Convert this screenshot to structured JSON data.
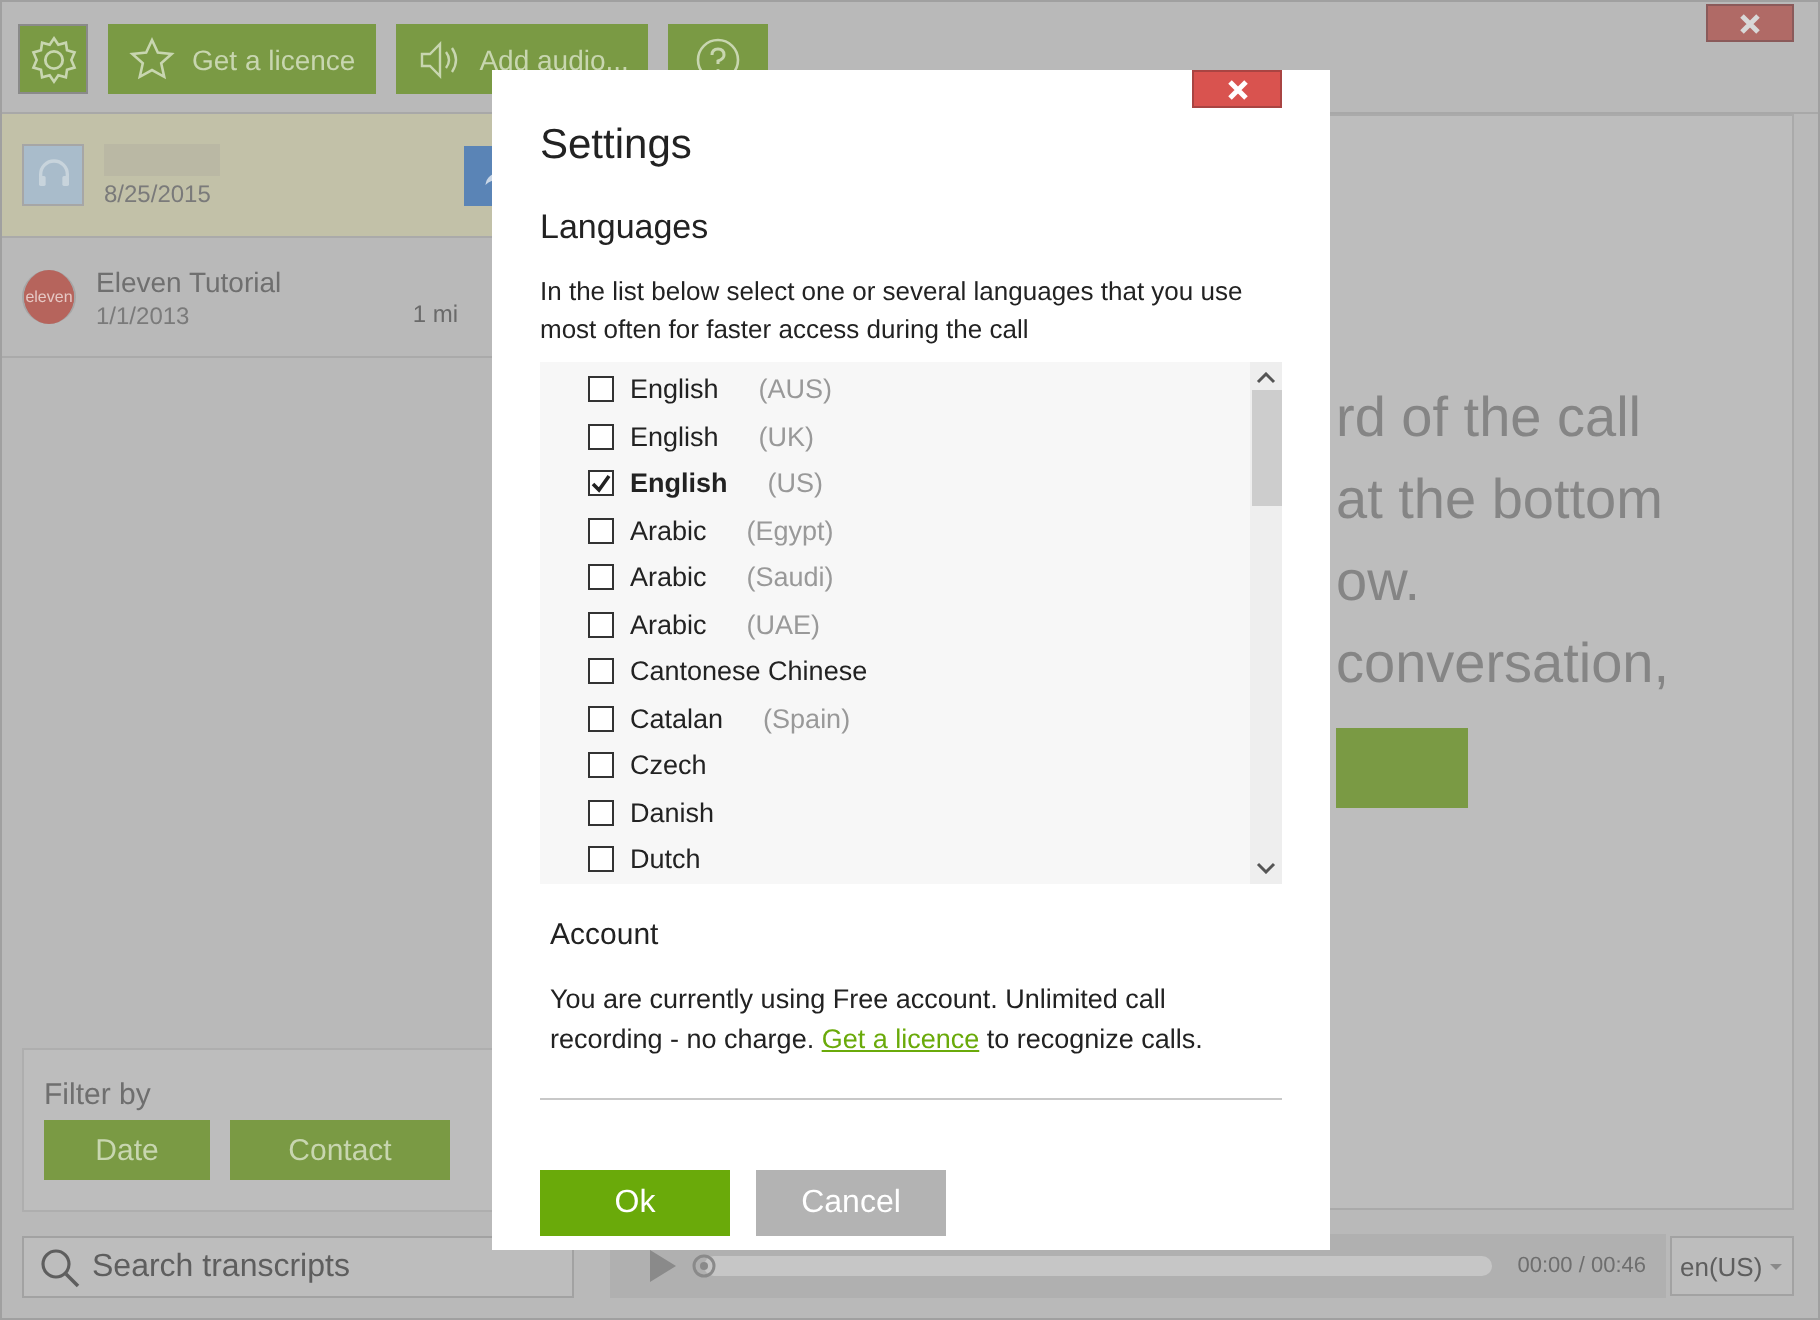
{
  "toolbar": [
    {
      "kind": "settings"
    },
    {
      "kind": "licence",
      "label": "Get a licence"
    },
    {
      "kind": "audio",
      "label": "Add audio..."
    },
    {
      "kind": "help"
    }
  ],
  "calls": [
    {
      "kind": "headset",
      "date": "8/25/2015",
      "selected": true
    },
    {
      "kind": "logo",
      "avatar_text": "eleven",
      "title": "Eleven Tutorial",
      "date": "1/1/2013",
      "duration": "1 mi",
      "selected": false
    }
  ],
  "filter": {
    "title": "Filter by",
    "buttons": [
      "Date",
      "Contact"
    ]
  },
  "search": {
    "placeholder": "Search transcripts"
  },
  "hint_lines": [
    "rd of the call",
    "at the bottom",
    "ow.",
    "conversation,"
  ],
  "player": {
    "level": 0,
    "time": "00:00 / 00:46"
  },
  "language_select": {
    "value": "en(US)"
  },
  "dialog": {
    "title": "Settings",
    "languages": {
      "heading": "Languages",
      "description": "In the list below select one or several languages that you use most often for faster access during the call",
      "items": [
        {
          "name": "English",
          "region": "(AUS)",
          "checked": false
        },
        {
          "name": "English",
          "region": "(UK)",
          "checked": false
        },
        {
          "name": "English",
          "region": "(US)",
          "checked": true
        },
        {
          "name": "Arabic",
          "region": "(Egypt)",
          "checked": false
        },
        {
          "name": "Arabic",
          "region": "(Saudi)",
          "checked": false
        },
        {
          "name": "Arabic",
          "region": "(UAE)",
          "checked": false
        },
        {
          "name": "Cantonese Chinese",
          "checked": false
        },
        {
          "name": "Catalan",
          "region": "(Spain)",
          "checked": false
        },
        {
          "name": "Czech",
          "checked": false
        },
        {
          "name": "Danish",
          "checked": false
        },
        {
          "name": "Dutch",
          "checked": false
        }
      ]
    },
    "account": {
      "heading": "Account",
      "text_before": "You are currently using Free account. Unlimited call recording - no charge.",
      "link": "Get a licence",
      "text_after": "to recognize calls."
    },
    "ok_button": "Ok",
    "cancel_button": "Cancel"
  }
}
